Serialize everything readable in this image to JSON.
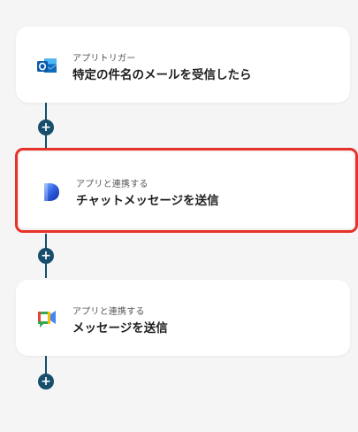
{
  "flow": {
    "steps": [
      {
        "subtitle": "アプリトリガー",
        "title": "特定の件名のメールを受信したら",
        "icon": "outlook-icon"
      },
      {
        "subtitle": "アプリと連携する",
        "title": "チャットメッセージを送信",
        "icon": "dify-icon",
        "selected": true
      },
      {
        "subtitle": "アプリと連携する",
        "title": "メッセージを送信",
        "icon": "google-chat-icon"
      }
    ],
    "add_symbol": "+"
  },
  "colors": {
    "connector": "#174e6b",
    "selection_outline": "#e63229",
    "background": "#f5f5f5"
  }
}
